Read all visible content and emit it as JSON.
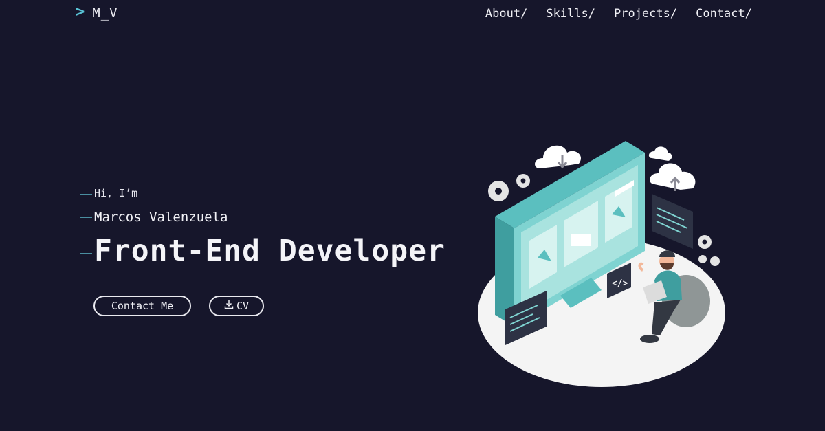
{
  "header": {
    "logo_text": "M_V",
    "logo_icon": "chevron-right-icon",
    "nav": [
      {
        "label": "About/"
      },
      {
        "label": "Skills/"
      },
      {
        "label": "Projects/"
      },
      {
        "label": "Contact/"
      }
    ]
  },
  "hero": {
    "greeting": "Hi, I’m",
    "name": "Marcos Valenzuela",
    "title": "Front-End Developer",
    "buttons": {
      "contact_label": "Contact Me",
      "cv_label": "CV",
      "cv_icon": "download-icon"
    }
  },
  "colors": {
    "background": "#16162b",
    "accent": "#59c3d6",
    "text": "#f1f1f6",
    "illustration_teal": "#7fd3d1",
    "platform": "#f4f4f4"
  }
}
